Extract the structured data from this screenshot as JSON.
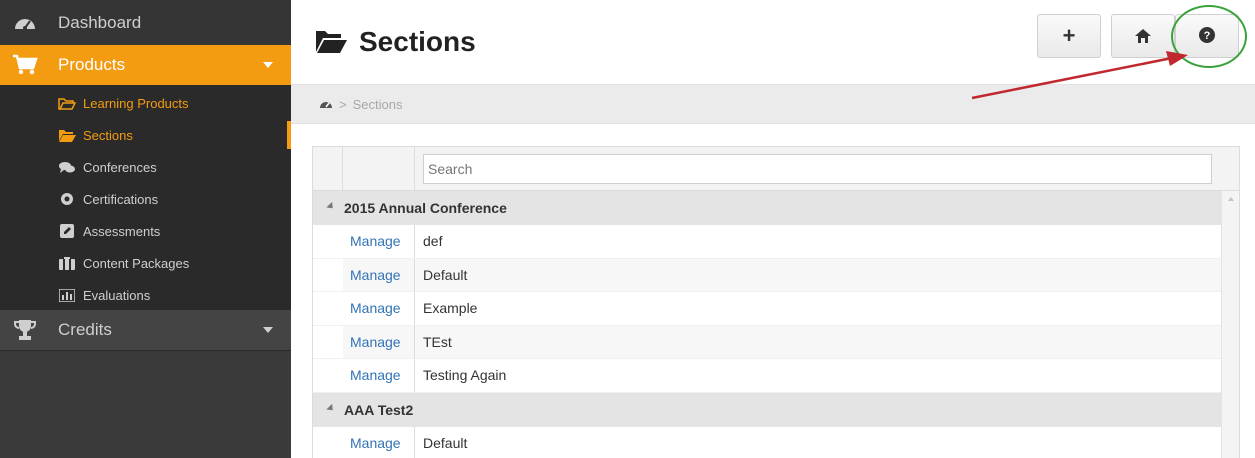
{
  "sidebar": {
    "dashboard": "Dashboard",
    "products": "Products",
    "products_items": [
      {
        "label": "Learning Products",
        "icon": "folder-open-outline-icon"
      },
      {
        "label": "Sections",
        "icon": "folder-open-icon"
      },
      {
        "label": "Conferences",
        "icon": "comments-icon"
      },
      {
        "label": "Certifications",
        "icon": "certificate-icon"
      },
      {
        "label": "Assessments",
        "icon": "pencil-square-icon"
      },
      {
        "label": "Content Packages",
        "icon": "briefcase-icon"
      },
      {
        "label": "Evaluations",
        "icon": "bar-chart-icon"
      }
    ],
    "credits": "Credits"
  },
  "header": {
    "title": "Sections",
    "add_button": "+",
    "home_icon": "home-icon",
    "help_icon": "question-circle-icon"
  },
  "breadcrumb": {
    "separator": ">",
    "current": "Sections"
  },
  "grid": {
    "search_placeholder": "Search",
    "groups": [
      {
        "name": "2015 Annual Conference",
        "rows": [
          {
            "action": "Manage",
            "name": "def"
          },
          {
            "action": "Manage",
            "name": "Default"
          },
          {
            "action": "Manage",
            "name": "Example"
          },
          {
            "action": "Manage",
            "name": "TEst"
          },
          {
            "action": "Manage",
            "name": "Testing Again"
          }
        ]
      },
      {
        "name": "AAA Test2",
        "rows": [
          {
            "action": "Manage",
            "name": "Default"
          }
        ]
      }
    ]
  },
  "colors": {
    "accent": "#f39c12",
    "sidebar_bg": "#3a3a3a",
    "link": "#3173b6",
    "annotation_arrow": "#c0282d",
    "annotation_circle": "#3aa23a"
  }
}
